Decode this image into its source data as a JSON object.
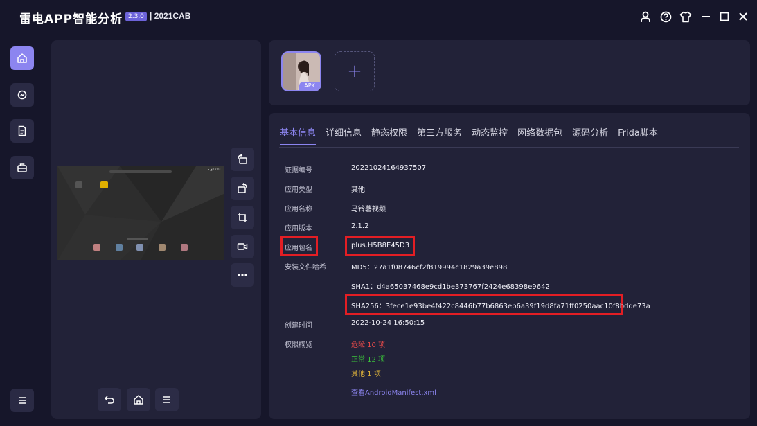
{
  "app": {
    "title": "雷电APP智能分析",
    "version": "2.3.0",
    "build": "| 2021CAB"
  },
  "window_controls": [
    "user-icon",
    "help-icon",
    "shirt-icon",
    "minimize-icon",
    "maximize-icon",
    "close-icon"
  ],
  "nav": {
    "items": [
      "home-icon",
      "analysis-icon",
      "report-icon",
      "toolbox-icon"
    ],
    "menu_icon": "menu-icon"
  },
  "apk": {
    "badge": "APK",
    "add_symbol": "+"
  },
  "device_screen": {
    "status_text": "▾ ◢ 12:01"
  },
  "tabs": [
    "基本信息",
    "详细信息",
    "静态权限",
    "第三方服务",
    "动态监控",
    "网络数据包",
    "源码分析",
    "Frida脚本"
  ],
  "info": {
    "cert_label": "证据编号",
    "cert_value": "20221024164937507",
    "type_label": "应用类型",
    "type_value": "其他",
    "name_label": "应用名称",
    "name_value": "马铃薯视频",
    "version_label": "应用版本",
    "version_value": "2.1.2",
    "package_label": "应用包名",
    "package_value": "plus.H5B8E45D3",
    "hash_label": "安装文件哈希",
    "md5": "MD5：27a1f08746cf2f819994c1829a39e898",
    "sha1": "SHA1：d4a65037468e9cd1be373767f2424e68398e9642",
    "sha256": "SHA256：3fece1e93be4f422c8446b77b6863eb6a39f19d8fa71ff0250aac10f8bdde73a",
    "created_label": "创建时间",
    "created_value": "2022-10-24 16:50:15",
    "perm_label": "权限概览",
    "perm_danger": "危险 10 项",
    "perm_normal": "正常 12 项",
    "perm_other": "其他 1 项",
    "manifest_link": "查看AndroidManifest.xml"
  },
  "colors": {
    "accent": "#8c85f0",
    "danger": "#e84a4a",
    "normal": "#3ac43a",
    "other": "#e0b43a",
    "highlight": "#e31e24"
  }
}
